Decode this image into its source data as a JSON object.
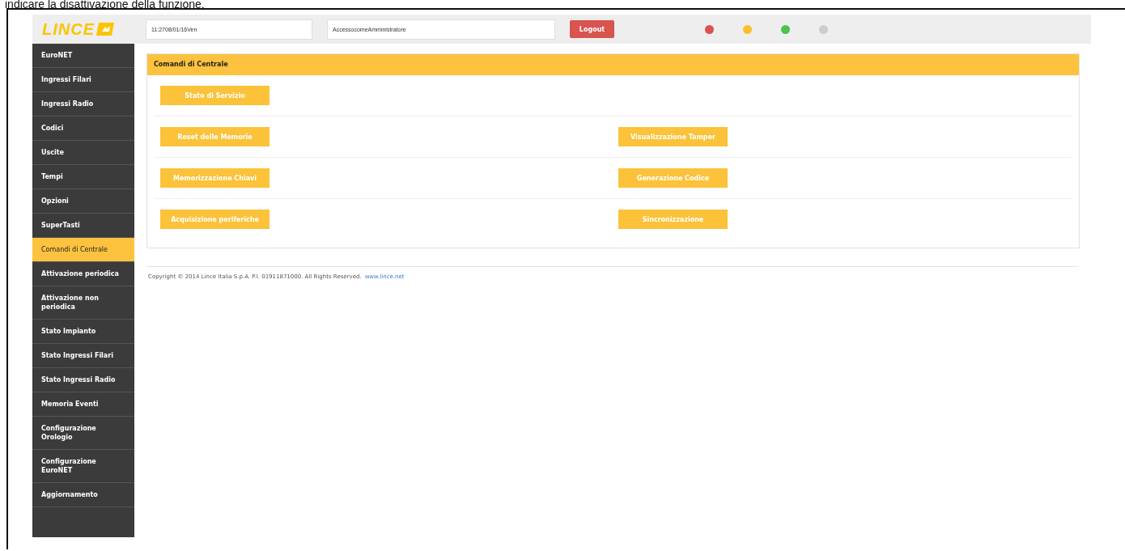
{
  "caption": "indicare la disattivazione della funzione.",
  "header": {
    "logo": "LINCE",
    "datetime": "11:2708/01/16Ven",
    "access": "AccessocomeAmministratore",
    "logout": "Logout",
    "status_dots": [
      {
        "color": "#d9534f"
      },
      {
        "color": "#fbc02d"
      },
      {
        "color": "#4cc44c"
      },
      {
        "color": "#cccccc"
      }
    ]
  },
  "sidebar": {
    "items": [
      {
        "label": "EuroNET",
        "selected": false
      },
      {
        "label": "Ingressi Filari",
        "selected": false
      },
      {
        "label": "Ingressi Radio",
        "selected": false
      },
      {
        "label": "Codici",
        "selected": false
      },
      {
        "label": "Uscite",
        "selected": false
      },
      {
        "label": "Tempi",
        "selected": false
      },
      {
        "label": "Opzioni",
        "selected": false
      },
      {
        "label": "SuperTasti",
        "selected": false
      },
      {
        "label": "Comandi di Centrale",
        "selected": true
      },
      {
        "label": "Attivazione periodica",
        "selected": false
      },
      {
        "label": "Attivazione non periodica",
        "selected": false
      },
      {
        "label": "Stato Impianto",
        "selected": false
      },
      {
        "label": "Stato Ingressi Filari",
        "selected": false
      },
      {
        "label": "Stato Ingressi Radio",
        "selected": false
      },
      {
        "label": "Memoria Eventi",
        "selected": false
      },
      {
        "label": "Configurazione Orologio",
        "selected": false
      },
      {
        "label": "Configurazione EuroNET",
        "selected": false
      },
      {
        "label": "Aggiornamento",
        "selected": false
      }
    ]
  },
  "panel": {
    "title": "Comandi di Centrale",
    "rows": [
      {
        "left": "Stato di Servizio"
      },
      {
        "left": "Reset delle Memorie",
        "right": "Visualizzazione Tamper"
      },
      {
        "left": "Memorizzazione Chiavi",
        "right": "Generazione Codice"
      },
      {
        "left": "Acquisizione periferiche",
        "right": "Sincronizzazione"
      }
    ]
  },
  "footer": {
    "copyright": "Copyright © 2014 Lince Italia S.p.A. P.I. 01911871000. All Rights Reserved.",
    "link": "www.lince.net"
  }
}
